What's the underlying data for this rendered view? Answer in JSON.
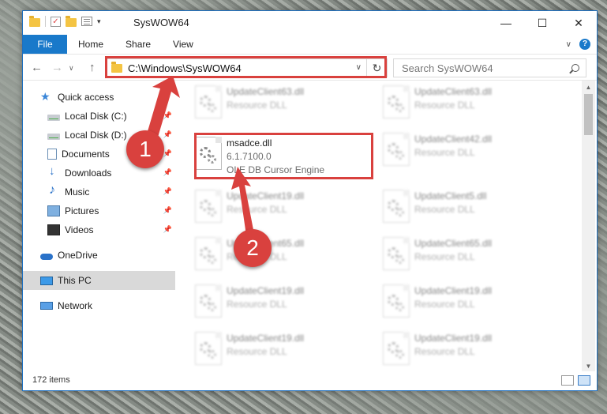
{
  "window": {
    "title": "SysWOW64",
    "controls": [
      "—",
      "☐",
      "✕"
    ]
  },
  "ribbon": {
    "tabs": [
      "File",
      "Home",
      "Share",
      "View"
    ],
    "help": "?"
  },
  "navbar": {
    "address": "C:\\Windows\\SysWOW64",
    "search_placeholder": "Search SysWOW64"
  },
  "sidebar": {
    "items": [
      {
        "label": "Quick access",
        "icon": "star-icon",
        "pinned": false
      },
      {
        "label": "Local Disk (C:)",
        "icon": "drive-icon",
        "pinned": true
      },
      {
        "label": "Local Disk (D:)",
        "icon": "drive-icon",
        "pinned": true
      },
      {
        "label": "Documents",
        "icon": "documents-icon",
        "pinned": true
      },
      {
        "label": "Downloads",
        "icon": "download-icon",
        "pinned": true
      },
      {
        "label": "Music",
        "icon": "music-icon",
        "pinned": true
      },
      {
        "label": "Pictures",
        "icon": "pictures-icon",
        "pinned": true
      },
      {
        "label": "Videos",
        "icon": "videos-icon",
        "pinned": true
      },
      {
        "label": "OneDrive",
        "icon": "cloud-icon",
        "pinned": false
      },
      {
        "label": "This PC",
        "icon": "computer-icon",
        "pinned": false,
        "selected": true
      },
      {
        "label": "Network",
        "icon": "network-icon",
        "pinned": false
      }
    ]
  },
  "files": {
    "highlighted": {
      "name": "msadce.dll",
      "version": "6.1.7100.0",
      "description": "OLE DB Cursor Engine"
    },
    "left_column": [
      {
        "name": "UpdateClient63.dll",
        "type": "Resource DLL"
      },
      {
        "name": "UpdateClient19.dll",
        "type": "Resource DLL"
      },
      {
        "name": "UpdateClient65.dll",
        "type": "Resource DLL"
      },
      {
        "name": "UpdateClient19.dll",
        "type": "Resource DLL"
      },
      {
        "name": "UpdateClient19.dll",
        "type": "Resource DLL"
      }
    ],
    "right_column": [
      {
        "name": "UpdateClient63.dll",
        "type": "Resource DLL"
      },
      {
        "name": "UpdateClient42.dll",
        "type": "Resource DLL"
      },
      {
        "name": "UpdateClient5.dll",
        "type": "Resource DLL"
      },
      {
        "name": "UpdateClient65.dll",
        "type": "Resource DLL"
      },
      {
        "name": "UpdateClient19.dll",
        "type": "Resource DLL"
      },
      {
        "name": "UpdateClient19.dll",
        "type": "Resource DLL"
      }
    ]
  },
  "status": {
    "item_count": "172 items"
  },
  "annotations": {
    "step1": "1",
    "step2": "2",
    "color": "#d9413e"
  }
}
